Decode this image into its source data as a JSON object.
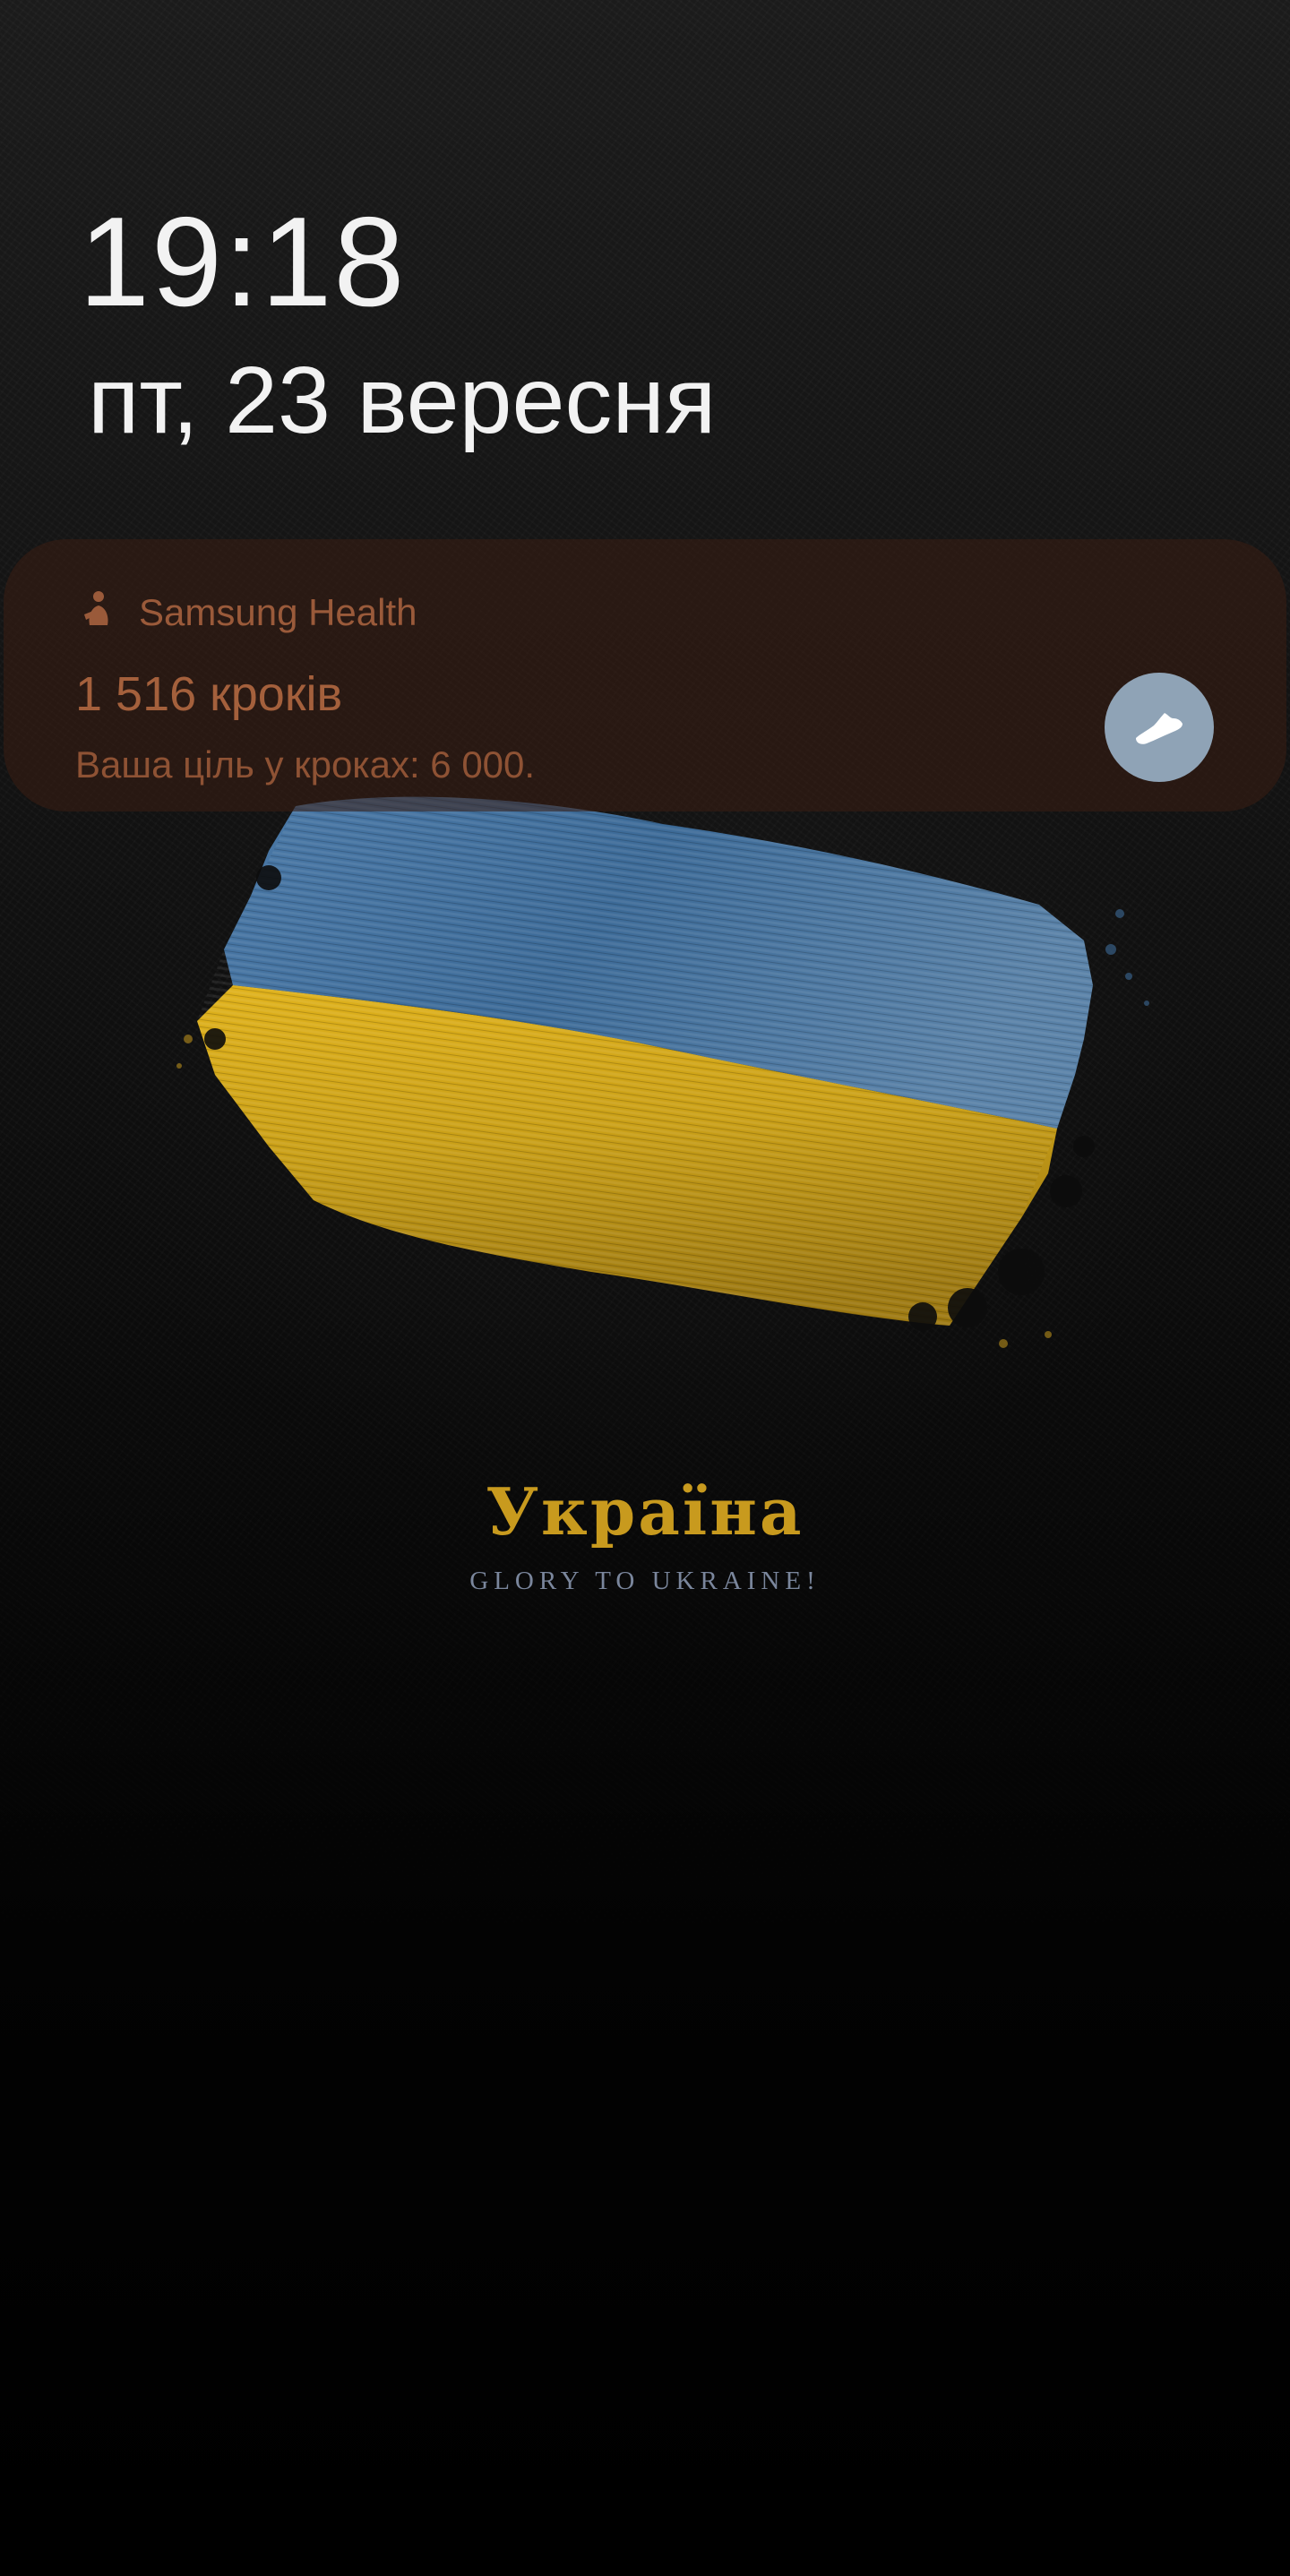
{
  "lockscreen": {
    "time": "19:18",
    "date": "пт, 23 вересня"
  },
  "notification": {
    "app_name": "Samsung Health",
    "title": "1 516 кроків",
    "body": "Ваша ціль у кроках: 6 000.",
    "app_icon": "samsung-health-runner-icon",
    "action_icon": "shoe-icon",
    "action_color": "#8fa3b6"
  },
  "wallpaper": {
    "title": "Україна",
    "subtitle": "GLORY TO UKRAINE!",
    "flag_colors": {
      "blue": "#3f6a96",
      "yellow": "#d8a91a"
    }
  }
}
